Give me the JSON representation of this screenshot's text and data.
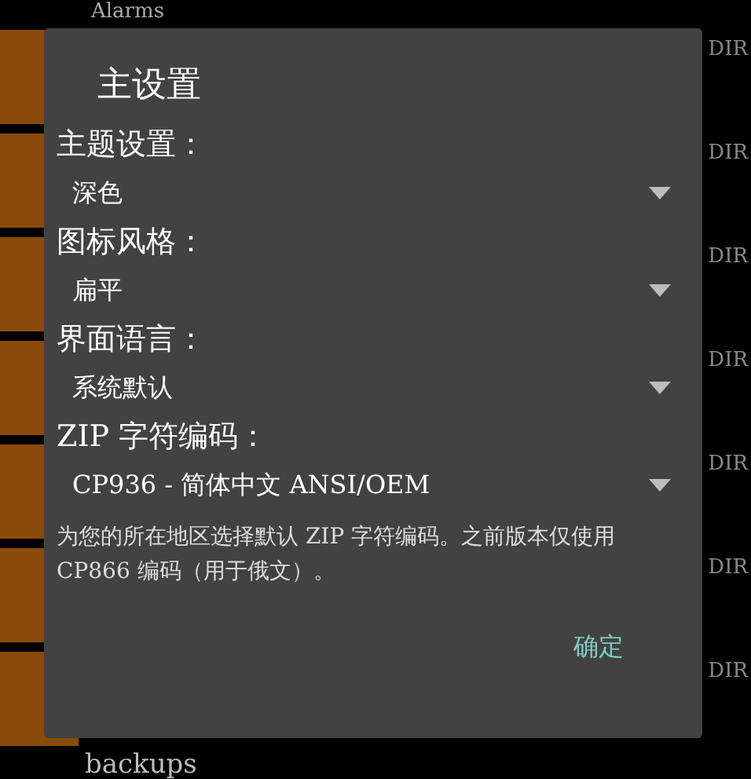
{
  "background": {
    "header_text": "Alarms",
    "dir_labels": [
      "DIR",
      "DIR",
      "DIR",
      "DIR",
      "DIR",
      "DIR",
      "DIR"
    ],
    "footer_text": "backups"
  },
  "dialog": {
    "title": "主设置",
    "settings": [
      {
        "label": "主题设置：",
        "value": "深色"
      },
      {
        "label": "图标风格：",
        "value": "扁平"
      },
      {
        "label": "界面语言：",
        "value": "系统默认"
      },
      {
        "label": "ZIP 字符编码：",
        "value": "CP936 - 简体中文 ANSI/OEM"
      }
    ],
    "description": "为您的所在地区选择默认 ZIP 字符编码。之前版本仅使用 CP866 编码（用于俄文）。",
    "button": "确定"
  }
}
